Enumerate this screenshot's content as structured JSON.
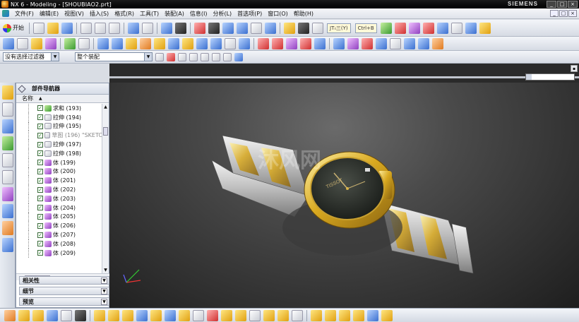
{
  "window": {
    "title": "NX 6 - Modeling - [SHOUBIAO2.prt]",
    "brand": "SIEMENS",
    "buttons": [
      "_",
      "□",
      "×"
    ]
  },
  "menubar": {
    "items": [
      "文件(F)",
      "编辑(E)",
      "视图(V)",
      "插入(S)",
      "格式(R)",
      "工具(T)",
      "装配(A)",
      "信息(I)",
      "分析(L)",
      "首选项(P)",
      "窗口(O)",
      "帮助(H)"
    ],
    "mdi_buttons": [
      "_",
      "□",
      "×"
    ]
  },
  "toolbar": {
    "start_label": "开始",
    "chip_one": "JTᵢᵢ三(Y)",
    "chip_two": "Ctrl+B"
  },
  "selection_bar": {
    "filter_value": "没有选择过滤器",
    "scope_value": "整个装配"
  },
  "navigator": {
    "title": "部件导航器",
    "column": "名称",
    "rows": [
      {
        "label": "求和 (193)",
        "icon": "unite-icon",
        "greyed": false
      },
      {
        "label": "拉伸 (194)",
        "icon": "extrude-icon",
        "greyed": false
      },
      {
        "label": "拉伸 (195)",
        "icon": "extrude-icon",
        "greyed": false
      },
      {
        "label": "草图 (196) \"SKETC",
        "icon": "sketch-icon",
        "greyed": true
      },
      {
        "label": "拉伸 (197)",
        "icon": "extrude-icon",
        "greyed": false
      },
      {
        "label": "拉伸 (198)",
        "icon": "extrude-icon",
        "greyed": false
      },
      {
        "label": "体 (199)",
        "icon": "body-icon",
        "greyed": false
      },
      {
        "label": "体 (200)",
        "icon": "body-icon",
        "greyed": false
      },
      {
        "label": "体 (201)",
        "icon": "body-icon",
        "greyed": false
      },
      {
        "label": "体 (202)",
        "icon": "body-icon",
        "greyed": false
      },
      {
        "label": "体 (203)",
        "icon": "body-icon",
        "greyed": false
      },
      {
        "label": "体 (204)",
        "icon": "body-icon",
        "greyed": false
      },
      {
        "label": "体 (205)",
        "icon": "body-icon",
        "greyed": false
      },
      {
        "label": "体 (206)",
        "icon": "body-icon",
        "greyed": false
      },
      {
        "label": "体 (207)",
        "icon": "body-icon",
        "greyed": false
      },
      {
        "label": "体 (208)",
        "icon": "body-icon",
        "greyed": false
      },
      {
        "label": "体 (209)",
        "icon": "body-icon",
        "greyed": false
      }
    ],
    "panels": [
      "相关性",
      "细节",
      "预览"
    ]
  },
  "viewport": {
    "watermark": "沐风网",
    "watch_brand": "TISSOT"
  }
}
